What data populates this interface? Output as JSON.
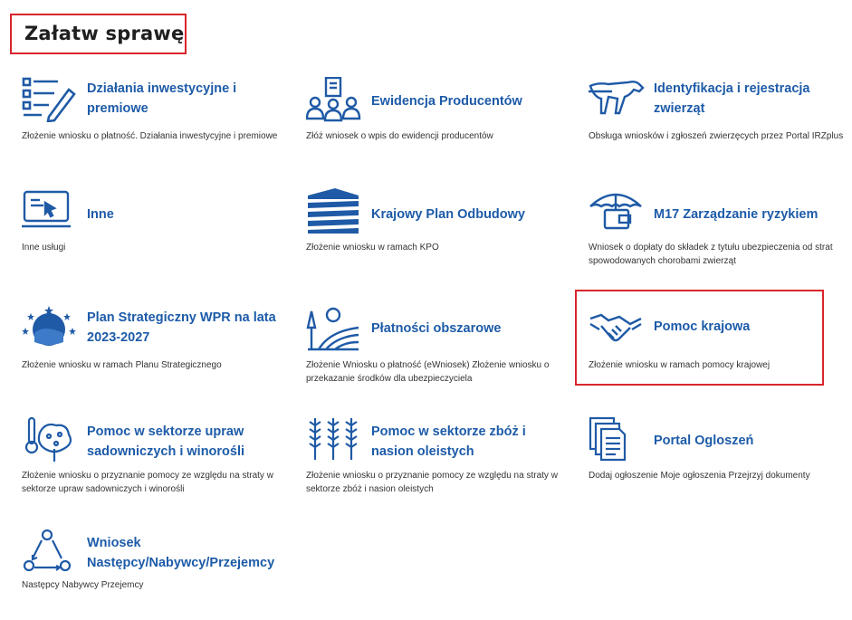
{
  "page": {
    "title": "Załatw sprawę"
  },
  "tiles": [
    {
      "icon": "list-pencil-icon",
      "title": "Działania inwestycyjne i premiowe",
      "desc": "Złożenie wniosku o płatność. Działania inwestycyjne i premiowe"
    },
    {
      "icon": "people-document-icon",
      "title": "Ewidencja Producentów",
      "desc": "Złóż wniosek o wpis do ewidencji producentów"
    },
    {
      "icon": "cow-icon",
      "title": "Identyfikacja i rejestracja zwierząt",
      "desc": "Obsługa wniosków i zgłoszeń zwierzęcych przez Portal IRZplus"
    },
    {
      "icon": "laptop-cursor-icon",
      "title": "Inne",
      "desc": "Inne usługi"
    },
    {
      "icon": "kpo-logo-icon",
      "title": "Krajowy Plan Odbudowy",
      "desc": "Złożenie wniosku w ramach KPO"
    },
    {
      "icon": "umbrella-wallet-icon",
      "title": "M17 Zarządzanie ryzykiem",
      "desc": "Wniosek o dopłaty do składek z tytułu ubezpieczenia od strat spowodowanych chorobami zwierząt"
    },
    {
      "icon": "eu-emblem-icon",
      "title": "Plan Strategiczny WPR na lata 2023-2027",
      "desc": "Złożenie wniosku w ramach Planu Strategicznego"
    },
    {
      "icon": "field-landscape-icon",
      "title": "Płatności obszarowe",
      "desc": "Złożenie Wniosku o płatność (eWniosek) Złożenie wniosku o przekazanie środków dla ubezpieczyciela"
    },
    {
      "icon": "handshake-icon",
      "title": "Pomoc krajowa",
      "desc": "Złożenie wniosku w ramach pomocy krajowej"
    },
    {
      "icon": "fruit-tree-thermometer-icon",
      "title": "Pomoc w sektorze upraw sadowniczych i winorośli",
      "desc": "Złożenie wniosku o przyznanie pomocy ze względu na straty w sektorze upraw sadowniczych i winorośli"
    },
    {
      "icon": "wheat-icon",
      "title": "Pomoc w sektorze zbóż i nasion oleistych",
      "desc": "Złożenie wniosku o przyznanie pomocy ze względu na straty w sektorze zbóż i nasion oleistych"
    },
    {
      "icon": "documents-stack-icon",
      "title": "Portal Ogloszeń",
      "desc": "Dodaj ogłoszenie Moje ogłoszenia Przejrzyj dokumenty"
    },
    {
      "icon": "cycle-people-icon",
      "title": "Wniosek Następcy/Nabywcy/Przejemcy",
      "desc": "Następcy Nabywcy Przejemcy"
    }
  ]
}
